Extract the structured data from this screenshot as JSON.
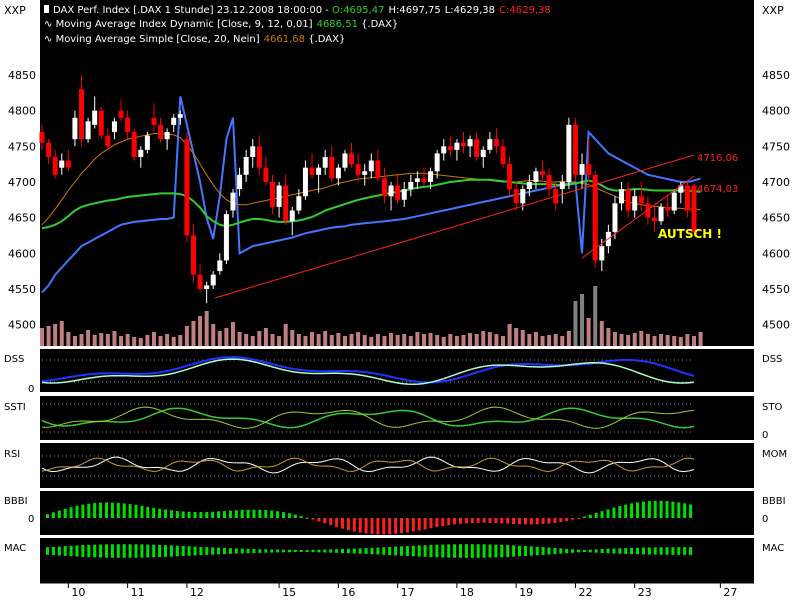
{
  "header": {
    "line1_prefix": "DAX Perf. Index [.DAX  1 Stunde] 23.12.2008 18:00:00 - ",
    "open": "O:4695,47",
    "high": "H:4697,75",
    "low": "L:4629,38",
    "close": "C:4629,38",
    "line2_label": "Moving Average Index Dynamic [Close, 9, 12, 0,01]",
    "line2_value": "4686,51",
    "line2_suffix": " {.DAX}",
    "line3_label": "Moving Average Simple [Close, 20, Nein]",
    "line3_value": "4661,68",
    "line3_suffix": " {.DAX}"
  },
  "corner_labels": {
    "left": "XXP",
    "right": "XXP"
  },
  "colors": {
    "bg": "#000000",
    "frame": "#ffffff",
    "up_candle": "#ffffff",
    "down_candle": "#ff0000",
    "ma_dynamic": "#33cc33",
    "ma_simple": "#cc7a00",
    "upper_band": "#4477ff",
    "trend": "#ff2020",
    "volume": "#c08080",
    "volume_high": "#808080",
    "annotation": "#ffff00",
    "green_bar": "#00e000",
    "red_bar": "#ff2020"
  },
  "annotations": {
    "autsch": "AUTSCH !",
    "level_upper": "4716,06",
    "level_lower": "4674,03"
  },
  "panels": {
    "dss": {
      "left": "DSS",
      "right": "DSS",
      "zero": "0"
    },
    "ssti": {
      "left": "SSTI",
      "right": "STO",
      "zero": "0"
    },
    "rsi": {
      "left": "RSI",
      "right": "MOM"
    },
    "bbbi": {
      "left": "BBBI",
      "right": "BBBI",
      "zero_left": "0",
      "zero_right": "0"
    },
    "mac": {
      "left": "MAC",
      "right": "MAC"
    }
  },
  "chart_data": {
    "type": "candlestick",
    "title": "DAX Perf. Index [.DAX  1 Stunde] 23.12.2008 18:00:00",
    "y_ticks": [
      4500,
      4550,
      4600,
      4650,
      4700,
      4750,
      4800,
      4850
    ],
    "ylim": [
      4470,
      4885
    ],
    "x_ticks": [
      "10",
      "11",
      "12",
      "15",
      "16",
      "17",
      "18",
      "19",
      "22",
      "23",
      "27"
    ],
    "x_tick_positions": [
      4,
      13,
      22,
      36,
      45,
      54,
      63,
      72,
      81,
      90,
      103
    ],
    "candles": [
      [
        4770,
        4780,
        4745,
        4755
      ],
      [
        4755,
        4760,
        4725,
        4735
      ],
      [
        4735,
        4745,
        4705,
        4710
      ],
      [
        4720,
        4740,
        4710,
        4730
      ],
      [
        4730,
        4745,
        4715,
        4720
      ],
      [
        4760,
        4800,
        4750,
        4790
      ],
      [
        4830,
        4850,
        4750,
        4760
      ],
      [
        4760,
        4790,
        4755,
        4785
      ],
      [
        4780,
        4820,
        4775,
        4800
      ],
      [
        4800,
        4805,
        4760,
        4765
      ],
      [
        4765,
        4775,
        4745,
        4750
      ],
      [
        4770,
        4790,
        4760,
        4785
      ],
      [
        4800,
        4815,
        4785,
        4790
      ],
      [
        4790,
        4800,
        4760,
        4770
      ],
      [
        4770,
        4775,
        4730,
        4735
      ],
      [
        4735,
        4750,
        4720,
        4745
      ],
      [
        4745,
        4770,
        4740,
        4765
      ],
      [
        4790,
        4810,
        4770,
        4780
      ],
      [
        4780,
        4790,
        4755,
        4760
      ],
      [
        4760,
        4775,
        4745,
        4770
      ],
      [
        4780,
        4795,
        4770,
        4790
      ],
      [
        4790,
        4800,
        4780,
        4795
      ],
      [
        4760,
        4770,
        4615,
        4625
      ],
      [
        4625,
        4640,
        4560,
        4570
      ],
      [
        4570,
        4585,
        4545,
        4550
      ],
      [
        4550,
        4560,
        4530,
        4555
      ],
      [
        4555,
        4575,
        4550,
        4570
      ],
      [
        4575,
        4600,
        4570,
        4590
      ],
      [
        4590,
        4660,
        4585,
        4655
      ],
      [
        4660,
        4690,
        4650,
        4685
      ],
      [
        4690,
        4720,
        4680,
        4710
      ],
      [
        4710,
        4745,
        4700,
        4735
      ],
      [
        4735,
        4760,
        4720,
        4750
      ],
      [
        4750,
        4765,
        4710,
        4720
      ],
      [
        4720,
        4735,
        4695,
        4700
      ],
      [
        4700,
        4710,
        4655,
        4665
      ],
      [
        4665,
        4700,
        4650,
        4695
      ],
      [
        4695,
        4710,
        4640,
        4645
      ],
      [
        4645,
        4665,
        4625,
        4660
      ],
      [
        4660,
        4690,
        4655,
        4680
      ],
      [
        4680,
        4730,
        4675,
        4720
      ],
      [
        4720,
        4740,
        4705,
        4710
      ],
      [
        4710,
        4725,
        4685,
        4720
      ],
      [
        4720,
        4745,
        4710,
        4735
      ],
      [
        4735,
        4750,
        4700,
        4705
      ],
      [
        4705,
        4725,
        4695,
        4720
      ],
      [
        4720,
        4745,
        4715,
        4740
      ],
      [
        4740,
        4755,
        4720,
        4725
      ],
      [
        4725,
        4740,
        4700,
        4710
      ],
      [
        4710,
        4725,
        4695,
        4715
      ],
      [
        4715,
        4740,
        4705,
        4730
      ],
      [
        4730,
        4745,
        4700,
        4705
      ],
      [
        4705,
        4720,
        4670,
        4680
      ],
      [
        4680,
        4700,
        4660,
        4695
      ],
      [
        4695,
        4710,
        4670,
        4675
      ],
      [
        4675,
        4700,
        4665,
        4690
      ],
      [
        4690,
        4710,
        4680,
        4700
      ],
      [
        4700,
        4715,
        4690,
        4705
      ],
      [
        4705,
        4720,
        4695,
        4700
      ],
      [
        4700,
        4720,
        4690,
        4715
      ],
      [
        4715,
        4745,
        4705,
        4740
      ],
      [
        4740,
        4760,
        4730,
        4750
      ],
      [
        4750,
        4765,
        4735,
        4745
      ],
      [
        4745,
        4760,
        4730,
        4755
      ],
      [
        4755,
        4770,
        4740,
        4750
      ],
      [
        4750,
        4765,
        4735,
        4760
      ],
      [
        4760,
        4770,
        4730,
        4735
      ],
      [
        4735,
        4750,
        4720,
        4745
      ],
      [
        4745,
        4770,
        4740,
        4760
      ],
      [
        4760,
        4775,
        4740,
        4750
      ],
      [
        4750,
        4760,
        4720,
        4725
      ],
      [
        4725,
        4735,
        4680,
        4690
      ],
      [
        4690,
        4700,
        4660,
        4670
      ],
      [
        4670,
        4695,
        4660,
        4690
      ],
      [
        4690,
        4710,
        4680,
        4700
      ],
      [
        4700,
        4720,
        4690,
        4715
      ],
      [
        4715,
        4730,
        4700,
        4710
      ],
      [
        4710,
        4720,
        4680,
        4690
      ],
      [
        4690,
        4700,
        4660,
        4670
      ],
      [
        4690,
        4710,
        4670,
        4700
      ],
      [
        4700,
        4790,
        4690,
        4780
      ],
      [
        4780,
        4790,
        4700,
        4710
      ],
      [
        4710,
        4740,
        4690,
        4725
      ],
      [
        4725,
        4760,
        4700,
        4710
      ],
      [
        4710,
        4715,
        4580,
        4590
      ],
      [
        4590,
        4620,
        4575,
        4610
      ],
      [
        4610,
        4640,
        4600,
        4630
      ],
      [
        4630,
        4680,
        4620,
        4670
      ],
      [
        4670,
        4700,
        4660,
        4690
      ],
      [
        4690,
        4700,
        4650,
        4660
      ],
      [
        4660,
        4690,
        4650,
        4680
      ],
      [
        4680,
        4700,
        4660,
        4670
      ],
      [
        4670,
        4680,
        4640,
        4650
      ],
      [
        4650,
        4665,
        4630,
        4645
      ],
      [
        4645,
        4670,
        4640,
        4665
      ],
      [
        4665,
        4680,
        4650,
        4660
      ],
      [
        4660,
        4690,
        4655,
        4685
      ],
      [
        4685,
        4700,
        4670,
        4695
      ],
      [
        4695,
        4700,
        4650,
        4660
      ],
      [
        4695,
        4698,
        4629,
        4629
      ]
    ],
    "series": [
      {
        "name": "Moving Average Index Dynamic [Close, 9, 12, 0,01]",
        "values": [
          4635,
          4637,
          4640,
          4645,
          4652,
          4660,
          4665,
          4668,
          4670,
          4672,
          4674,
          4675,
          4677,
          4679,
          4680,
          4681,
          4682,
          4683,
          4684,
          4684,
          4684,
          4683,
          4680,
          4673,
          4664,
          4652,
          4645,
          4640,
          4638,
          4640,
          4643,
          4646,
          4648,
          4648,
          4647,
          4645,
          4644,
          4644,
          4645,
          4646,
          4648,
          4651,
          4655,
          4660,
          4663,
          4666,
          4669,
          4672,
          4675,
          4677,
          4679,
          4681,
          4683,
          4685,
          4686,
          4688,
          4690,
          4692,
          4693,
          4694,
          4696,
          4698,
          4700,
          4701,
          4702,
          4703,
          4703,
          4703,
          4703,
          4702,
          4701,
          4700,
          4699,
          4698,
          4697,
          4697,
          4697,
          4697,
          4696,
          4695,
          4696,
          4698,
          4700,
          4702,
          4700,
          4695,
          4690,
          4688,
          4688,
          4689,
          4690,
          4690,
          4689,
          4688,
          4688,
          4688,
          4688,
          4688,
          4688,
          4687,
          4686
        ]
      },
      {
        "name": "Moving Average Simple [Close, 20, Nein]",
        "values": [
          4640,
          4650,
          4662,
          4675,
          4688,
          4700,
          4712,
          4722,
          4732,
          4740,
          4746,
          4752,
          4756,
          4760,
          4762,
          4764,
          4766,
          4768,
          4768,
          4767,
          4766,
          4762,
          4752,
          4740,
          4725,
          4710,
          4696,
          4684,
          4675,
          4670,
          4668,
          4668,
          4670,
          4672,
          4674,
          4676,
          4678,
          4680,
          4682,
          4684,
          4686,
          4688,
          4690,
          4692,
          4695,
          4698,
          4700,
          4702,
          4704,
          4705,
          4706,
          4707,
          4708,
          4709,
          4710,
          4711,
          4712,
          4712,
          4712,
          4711,
          4710,
          4709,
          4708,
          4707,
          4706,
          4705,
          4704,
          4703,
          4702,
          4701,
          4700,
          4700,
          4700,
          4701,
          4702,
          4702,
          4701,
          4700,
          4700,
          4701,
          4700,
          4699,
          4698,
          4696,
          4692,
          4688,
          4684,
          4680,
          4676,
          4672,
          4670,
          4668,
          4667,
          4666,
          4665,
          4664,
          4663,
          4663,
          4662,
          4662,
          4661
        ]
      },
      {
        "name": "upper band",
        "values": [
          4545,
          4555,
          4570,
          4580,
          4590,
          4600,
          4610,
          4615,
          4620,
          4625,
          4630,
          4635,
          4640,
          4642,
          4644,
          4645,
          4646,
          4647,
          4648,
          4648,
          4650,
          4820,
          4780,
          4740,
          4700,
          4650,
          4620,
          4680,
          4760,
          4790,
          4600,
          4605,
          4610,
          4612,
          4614,
          4616,
          4618,
          4620,
          4622,
          4625,
          4628,
          4630,
          4632,
          4634,
          4636,
          4637,
          4638,
          4640,
          4641,
          4642,
          4643,
          4644,
          4645,
          4646,
          4647,
          4648,
          4650,
          4652,
          4654,
          4656,
          4658,
          4660,
          4662,
          4664,
          4666,
          4668,
          4670,
          4672,
          4674,
          4676,
          4678,
          4680,
          4682,
          4684,
          4686,
          4688,
          4690,
          4692,
          4694,
          4696,
          4698,
          4700,
          4600,
          4770,
          4760,
          4750,
          4740,
          4735,
          4730,
          4725,
          4720,
          4715,
          4710,
          4708,
          4706,
          4704,
          4702,
          4700,
          4700,
          4702,
          4705
        ]
      }
    ],
    "volume": [
      18,
      20,
      22,
      25,
      14,
      10,
      12,
      16,
      11,
      13,
      12,
      15,
      10,
      12,
      9,
      8,
      11,
      14,
      10,
      12,
      9,
      11,
      20,
      25,
      30,
      35,
      22,
      15,
      18,
      24,
      14,
      12,
      10,
      15,
      18,
      12,
      10,
      22,
      16,
      12,
      10,
      14,
      12,
      15,
      11,
      13,
      10,
      12,
      14,
      11,
      9,
      12,
      10,
      13,
      11,
      12,
      10,
      14,
      12,
      13,
      11,
      9,
      12,
      10,
      11,
      13,
      12,
      15,
      14,
      12,
      10,
      22,
      18,
      16,
      12,
      14,
      10,
      11,
      12,
      10,
      15,
      45,
      52,
      28,
      60,
      25,
      18,
      14,
      12,
      11,
      13,
      15,
      12,
      10,
      12,
      11,
      10,
      9,
      12,
      10,
      14
    ]
  }
}
